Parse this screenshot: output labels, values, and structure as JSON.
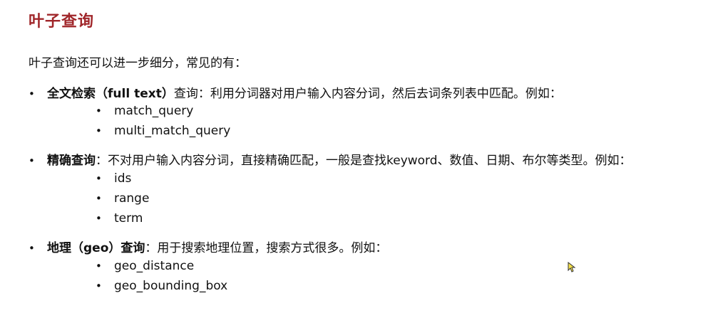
{
  "title": "叶子查询",
  "intro": "叶子查询还可以进一步细分，常见的有：",
  "bullet_main": "•",
  "bullet_sub": "•",
  "sections": [
    {
      "term": "全文检索（full text）",
      "rest": "查询：利用分词器对用户输入内容分词，然后去词条列表中匹配。例如：",
      "items": [
        "match_query",
        "multi_match_query"
      ]
    },
    {
      "term": "精确查询",
      "rest": "：不对用户输入内容分词，直接精确匹配，一般是查找keyword、数值、日期、布尔等类型。例如：",
      "items": [
        "ids",
        "range",
        "term"
      ]
    },
    {
      "term": "地理（geo）查询",
      "rest": "：用于搜索地理位置，搜索方式很多。例如：",
      "items": [
        "geo_distance",
        "geo_bounding_box"
      ]
    }
  ]
}
